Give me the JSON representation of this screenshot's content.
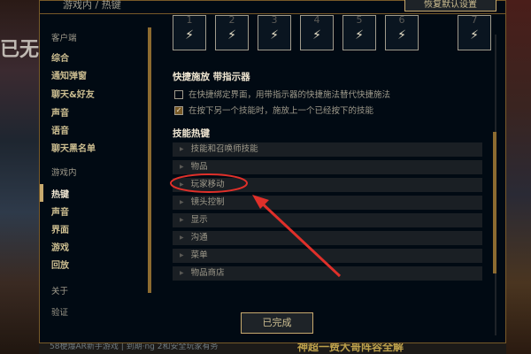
{
  "background": {
    "left_text": "已无",
    "bottom_text": "58梗爆AR新手游戏 | 到期·ng 2和安全玩家有务",
    "promo_text": "神超一费大哥阵容全解"
  },
  "dialog": {
    "breadcrumb": "游戏内 / 热键",
    "reset_label": "恢复默认设置",
    "done_label": "已完成"
  },
  "nav": {
    "section_client": "客户端",
    "client_items": [
      "综合",
      "通知弹窗",
      "聊天&好友",
      "声音",
      "语音",
      "聊天黑名单"
    ],
    "section_ingame": "游戏内",
    "ingame_items": [
      "热键",
      "声音",
      "界面",
      "游戏",
      "回放"
    ],
    "section_about": "关于",
    "about_items": [
      "验证"
    ]
  },
  "keys": {
    "labels": [
      "1",
      "2",
      "3",
      "4",
      "5",
      "6",
      "7"
    ],
    "bolt": "⚡"
  },
  "quickcast": {
    "title": "快捷施放 带指示器",
    "option1": "在快捷绑定界面，用带指示器的快捷施法替代快捷施法",
    "option1_checked": false,
    "option2": "在按下另一个技能时，施放上一个已经按下的技能",
    "option2_checked": true
  },
  "skills": {
    "title": "技能热键",
    "items": [
      "技能和召唤师技能",
      "物品",
      "玩家移动",
      "镜头控制",
      "显示",
      "沟通",
      "菜单",
      "物品商店"
    ],
    "highlighted": "玩家移动"
  },
  "colors": {
    "gold": "#c8aa6e",
    "annotation": "#e0302a"
  }
}
